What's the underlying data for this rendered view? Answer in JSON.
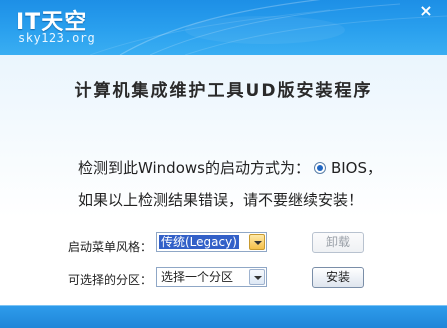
{
  "header": {
    "logo_title": "IT天空",
    "logo_subtitle": "sky123.org",
    "close_label": "×"
  },
  "main": {
    "app_title": "计算机集成维护工具UD版安装程序",
    "detect_prefix": "检测到此Windows的启动方式为：",
    "detect_mode": "BIOS，",
    "warning": "如果以上检测结果错误，请不要继续安装！"
  },
  "form": {
    "boot_menu_label": "启动菜单风格：",
    "boot_menu_value": "传统(Legacy)",
    "uninstall_label": "卸载",
    "partition_label": "可选择的分区：",
    "partition_value": "选择一个分区",
    "install_label": "安装"
  },
  "colors": {
    "header_blue": "#2aa0ee",
    "footer_blue": "#1f86d8",
    "selection_blue": "#3260c8"
  }
}
